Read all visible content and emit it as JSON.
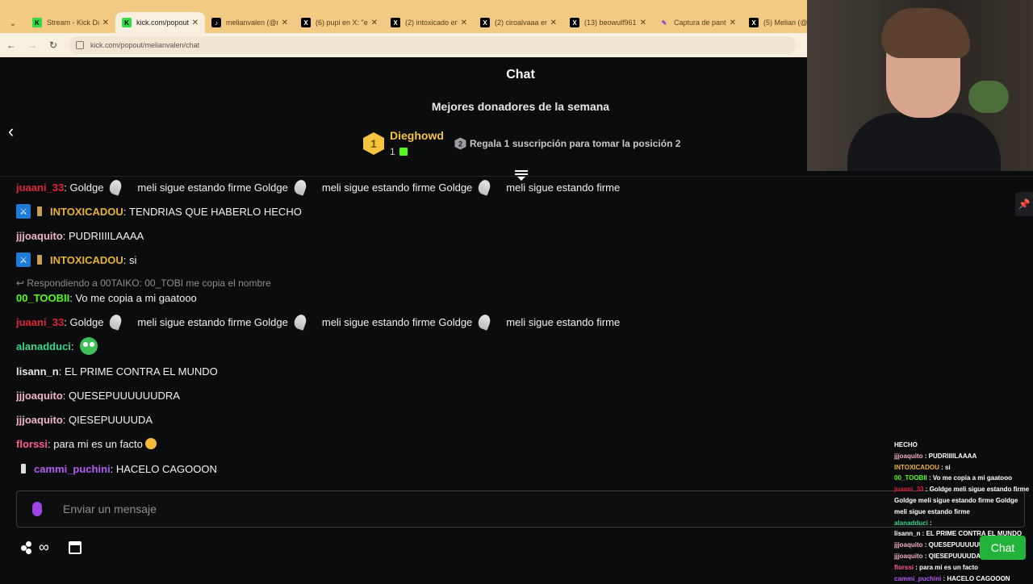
{
  "browser": {
    "tabs": [
      {
        "title": "Stream - Kick Da",
        "favicon": "kick"
      },
      {
        "title": "kick.com/popout",
        "favicon": "kick",
        "active": true
      },
      {
        "title": "melianvalen (@m",
        "favicon": "tiktok"
      },
      {
        "title": "(6) pupi en X: \"el",
        "favicon": "x"
      },
      {
        "title": "(2) intoxicado en",
        "favicon": "x"
      },
      {
        "title": "(2) ciroalvaaa en",
        "favicon": "x"
      },
      {
        "title": "(13) beowulf961",
        "favicon": "x"
      },
      {
        "title": "Captura de pant",
        "favicon": "snip"
      },
      {
        "title": "(5) Melian (@m",
        "favicon": "x"
      }
    ],
    "url": "kick.com/popout/melianvalen/chat"
  },
  "header": {
    "title": "Chat",
    "top_donors_title": "Mejores donadores de la semana",
    "donor": {
      "rank": "1",
      "name": "Dieghowd",
      "gift_count": "1"
    },
    "position2": {
      "rank": "2",
      "text": "Regala 1 suscripción para tomar la posición 2"
    }
  },
  "messages": [
    {
      "user": "juaani_33",
      "user_color": "#e0243a",
      "parts": [
        "Goldge",
        "meli sigue estando firme Goldge",
        "meli sigue estando firme Goldge",
        "meli sigue estando firme"
      ]
    },
    {
      "user": "INTOXICADOU",
      "user_color": "#e8b23a",
      "text": "TENDRIAS QUE HABERLO HECHO"
    },
    {
      "user": "jjjoaquito",
      "user_color": "#f2b3c9",
      "text": "PUDRIIIILAAAA"
    },
    {
      "user": "INTOXICADOU",
      "user_color": "#e8b23a",
      "text": "si"
    },
    {
      "reply": "Respondiendo a 00TAIKO: 00_TOBI me copia el nombre"
    },
    {
      "user": "00_TOOBII",
      "user_color": "#53fc18",
      "text": "Vo me copia a mi gaatooo"
    },
    {
      "user": "juaani_33",
      "user_color": "#e0243a",
      "parts": [
        "Goldge",
        "meli sigue estando firme Goldge",
        "meli sigue estando firme Goldge",
        "meli sigue estando firme"
      ]
    },
    {
      "user": "alanadduci",
      "user_color": "#3dd68c",
      "text": ""
    },
    {
      "user": "lisann_n",
      "user_color": "#e8e8e8",
      "text": "EL PRIME CONTRA EL MUNDO"
    },
    {
      "user": "jjjoaquito",
      "user_color": "#f2b3c9",
      "text": "QUESEPUUUUUUDRA"
    },
    {
      "user": "jjjoaquito",
      "user_color": "#f2b3c9",
      "text": "QIESEPUUUUDA"
    },
    {
      "user": "florssi",
      "user_color": "#ff5a8a",
      "text": "para mi es un facto"
    },
    {
      "user": "cammi_puchini",
      "user_color": "#b65cf0",
      "text": "HACELO CAGOOON"
    }
  ],
  "input": {
    "placeholder": "Enviar un mensaje"
  },
  "overlay": {
    "lines": [
      {
        "user": "",
        "text": "HECHO"
      },
      {
        "user": "jjjoaquito",
        "text": "PUDRIIIILAAAA"
      },
      {
        "user": "INTOXICADOU",
        "text": "si"
      },
      {
        "user": "00_TOOBII",
        "text": "Vo me copia a mi gaatooo"
      },
      {
        "user": "juaani_33",
        "text": "Goldge meli sigue estando firme Goldge meli sigue estando firme Goldge meli sigue estando firme"
      },
      {
        "user": "alanadduci",
        "text": ""
      },
      {
        "user": "lisann_n",
        "text": "EL PRIME CONTRA EL MUNDO"
      },
      {
        "user": "jjjoaquito",
        "text": "QUESEPUUUUUUDRA"
      },
      {
        "user": "jjjoaquito",
        "text": "QIESEPUUUUDA"
      },
      {
        "user": "florssi",
        "text": "para mi es un facto"
      },
      {
        "user": "cammi_puchini",
        "text": "HACELO CAGOOON"
      }
    ],
    "chat_button": "Chat"
  }
}
